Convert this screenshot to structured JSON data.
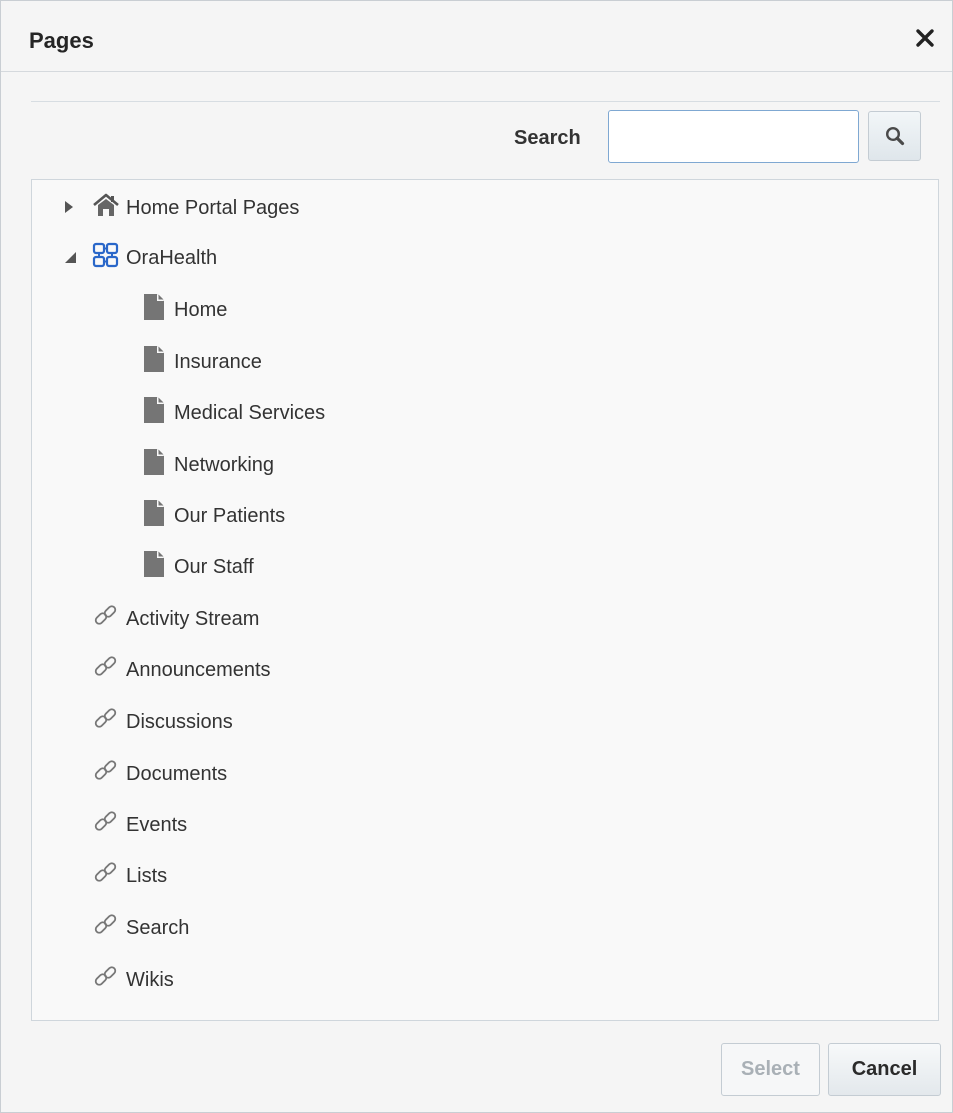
{
  "dialog": {
    "title": "Pages",
    "close_icon": "close-icon"
  },
  "search": {
    "label": "Search",
    "value": "",
    "placeholder": "",
    "button_icon": "magnifier-icon"
  },
  "tree": [
    {
      "label": "Home Portal Pages",
      "icon": "home-icon",
      "expanded": false
    },
    {
      "label": "OraHealth",
      "icon": "portal-icon",
      "expanded": true,
      "children": [
        {
          "label": "Home",
          "icon": "page-icon"
        },
        {
          "label": "Insurance",
          "icon": "page-icon"
        },
        {
          "label": "Medical Services",
          "icon": "page-icon"
        },
        {
          "label": "Networking",
          "icon": "page-icon"
        },
        {
          "label": "Our Patients",
          "icon": "page-icon"
        },
        {
          "label": "Our Staff",
          "icon": "page-icon"
        }
      ]
    },
    {
      "label": "Activity Stream",
      "icon": "link-icon"
    },
    {
      "label": "Announcements",
      "icon": "link-icon"
    },
    {
      "label": "Discussions",
      "icon": "link-icon"
    },
    {
      "label": "Documents",
      "icon": "link-icon"
    },
    {
      "label": "Events",
      "icon": "link-icon"
    },
    {
      "label": "Lists",
      "icon": "link-icon"
    },
    {
      "label": "Search",
      "icon": "link-icon"
    },
    {
      "label": "Wikis",
      "icon": "link-icon"
    }
  ],
  "footer": {
    "select_label": "Select",
    "select_enabled": false,
    "cancel_label": "Cancel"
  },
  "colors": {
    "dialog_bg": "#f5f5f5",
    "panel_bg": "#f9f9f9",
    "input_border": "#7fa8d2",
    "portal_icon": "#2a67c9",
    "page_icon": "#757575",
    "disabled_text": "#a9b0b6"
  }
}
